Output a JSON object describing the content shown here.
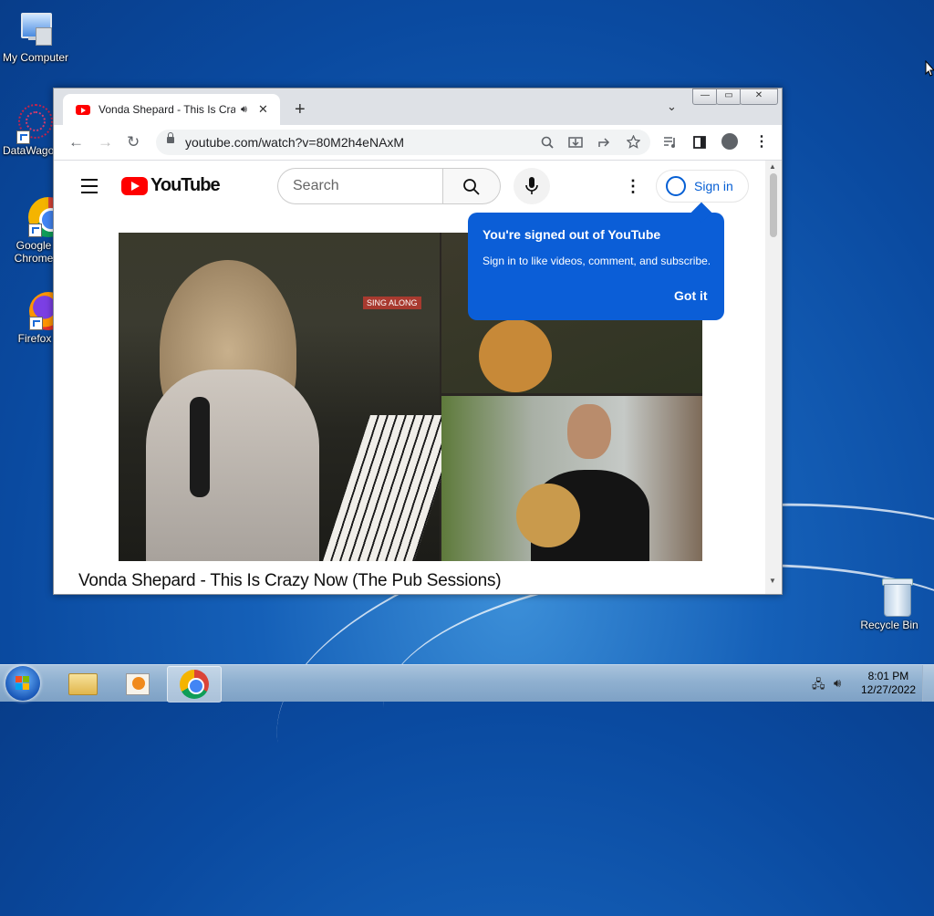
{
  "desktop": {
    "icons": [
      {
        "label": "My Computer"
      },
      {
        "label": "DataWagon"
      },
      {
        "label": "Google Chrome"
      },
      {
        "label": "Firefox"
      },
      {
        "label": "Recycle Bin"
      }
    ]
  },
  "browser": {
    "tab": {
      "title": "Vonda Shepard - This Is Crazy Now (The Pub Sessions)",
      "close": "✕"
    },
    "new_tab": "+",
    "tab_search": "⌄",
    "window_controls": {
      "minimize": "—",
      "maximize": "▭",
      "close": "✕"
    },
    "nav": {
      "back": "←",
      "forward": "→",
      "reload": "↻"
    },
    "url": "youtube.com/watch?v=80M2h4eNAxM",
    "toolbar_icons": [
      "search-icon",
      "install-icon",
      "share-icon",
      "star-icon",
      "media-icon",
      "sidepanel-icon",
      "profile-icon",
      "menu-icon"
    ]
  },
  "youtube": {
    "logo_text": "YouTube",
    "search_placeholder": "Search",
    "signin_label": "Sign in",
    "video_title": "Vonda Shepard - This Is Crazy Now (The Pub Sessions)",
    "video_sign": "SING ALONG",
    "tooltip": {
      "title": "You're signed out of YouTube",
      "body": "Sign in to like videos, comment, and subscribe.",
      "button": "Got it"
    }
  },
  "taskbar": {
    "time": "8:01 PM",
    "date": "12/27/2022",
    "items": [
      "file-explorer",
      "media-player",
      "google-chrome"
    ],
    "active": "google-chrome"
  },
  "colors": {
    "youtube_red": "#ff0000",
    "tooltip_blue": "#0b5ed7",
    "link_blue": "#065fd4"
  }
}
